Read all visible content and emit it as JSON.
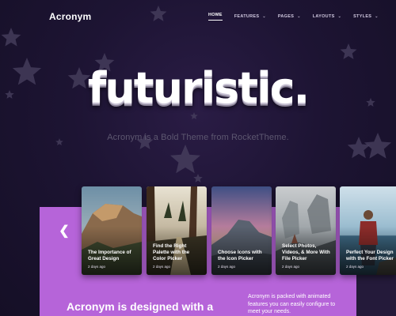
{
  "header": {
    "logo": "Acronym",
    "nav": [
      {
        "label": "HOME",
        "active": true,
        "has_dropdown": false
      },
      {
        "label": "FEATURES",
        "active": false,
        "has_dropdown": true
      },
      {
        "label": "PAGES",
        "active": false,
        "has_dropdown": true
      },
      {
        "label": "LAYOUTS",
        "active": false,
        "has_dropdown": true
      },
      {
        "label": "STYLES",
        "active": false,
        "has_dropdown": true
      }
    ]
  },
  "hero": {
    "title": "futuristic.",
    "subtitle": "Acronym is a Bold Theme from RocketTheme."
  },
  "carousel": {
    "prev_icon": "chevron-left-icon",
    "cards": [
      {
        "title": "The Importance of Great Design",
        "date": "2 days ago",
        "image": "mountain-cliff"
      },
      {
        "title": "Find the Right Palette with the Color Picker",
        "date": "2 days ago",
        "image": "forest-road"
      },
      {
        "title": "Choose Icons with the Icon Picker",
        "date": "2 days ago",
        "image": "half-dome-dusk"
      },
      {
        "title": "Select Photos, Videos, & More With File Picker",
        "date": "2 days ago",
        "image": "misty-rocks"
      },
      {
        "title": "Perfect Your Design with the Font Picker",
        "date": "2 days ago",
        "image": "person-sea"
      }
    ]
  },
  "panel": {
    "heading": "Acronym is designed with a",
    "text": "Acronym is packed with animated features you can easily configure to meet your needs."
  },
  "colors": {
    "background": "#1c1330",
    "panel": "#b664d9",
    "star": "#4a4160"
  }
}
